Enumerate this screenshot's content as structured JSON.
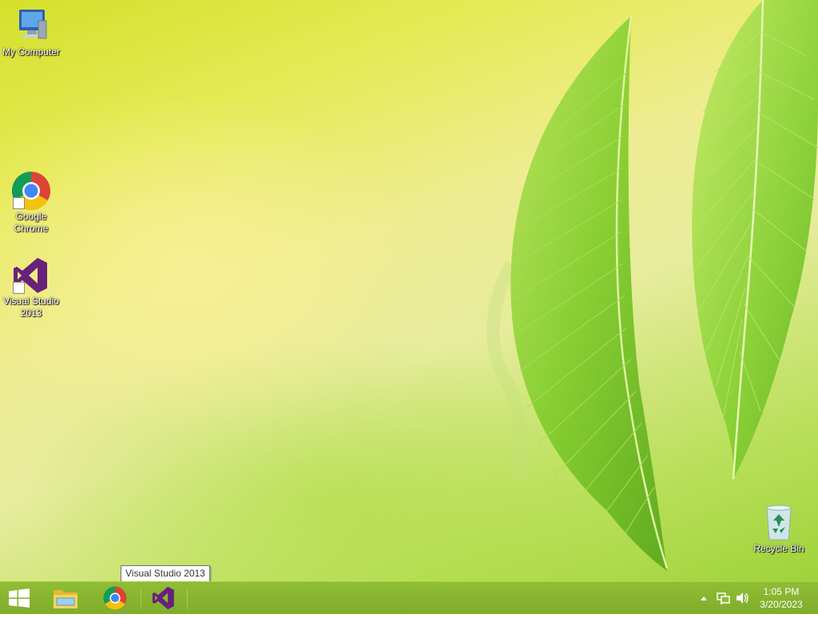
{
  "desktop": {
    "icons": [
      {
        "label": "My Computer",
        "icon": "computer-icon"
      },
      {
        "label": "Google Chrome",
        "icon": "chrome-icon"
      },
      {
        "label": "Visual Studio 2013",
        "icon": "visual-studio-icon"
      },
      {
        "label": "Recycle Bin",
        "icon": "recycle-bin-icon"
      }
    ],
    "wallpaper": "green leaves on yellow-green background"
  },
  "taskbar": {
    "start": {
      "icon": "windows-logo-icon"
    },
    "pinned": [
      {
        "name": "File Explorer",
        "icon": "folder-icon"
      },
      {
        "name": "Google Chrome",
        "icon": "chrome-icon"
      },
      {
        "name": "Visual Studio 2013",
        "icon": "visual-studio-icon"
      }
    ],
    "tooltip": "Visual Studio 2013",
    "tray": {
      "icons": [
        "show-hidden-icons-icon",
        "network-icon",
        "volume-icon"
      ],
      "time": "1:05 PM",
      "date": "3/20/2023"
    }
  },
  "colors": {
    "taskbar": "#86b530",
    "vs_purple": "#68217a",
    "chrome_red": "#db4437",
    "chrome_yellow": "#f4c20d",
    "chrome_green": "#0f9d58",
    "chrome_blue": "#4285f4"
  }
}
